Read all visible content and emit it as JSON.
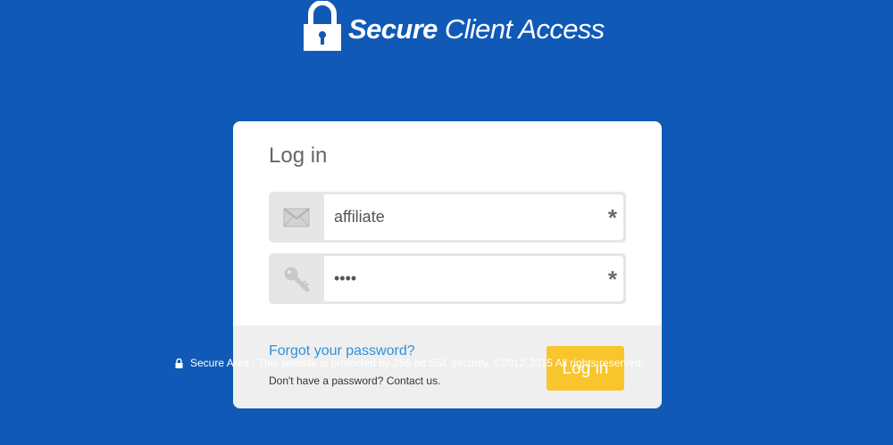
{
  "brand": {
    "title_bold": "Secure",
    "title_light": " Client Access",
    "icon": "padlock-icon"
  },
  "login_card": {
    "heading": "Log in",
    "email": {
      "value": "affiliate",
      "icon": "envelope-icon",
      "required_mark": "*"
    },
    "password": {
      "value": "test",
      "icon": "key-icon",
      "required_mark": "*"
    },
    "forgot_link": "Forgot your password?",
    "contact_text": "Don't have a password? Contact us.",
    "submit_label": "Log in"
  },
  "footer": {
    "icon": "small-lock-icon",
    "text": "Secure Area | This website is protected by 256-bit SSL security. ©2012-2015 All rights reserved."
  },
  "colors": {
    "background": "#1159b6",
    "accent_button": "#f8c52c",
    "link": "#2f91d8"
  }
}
